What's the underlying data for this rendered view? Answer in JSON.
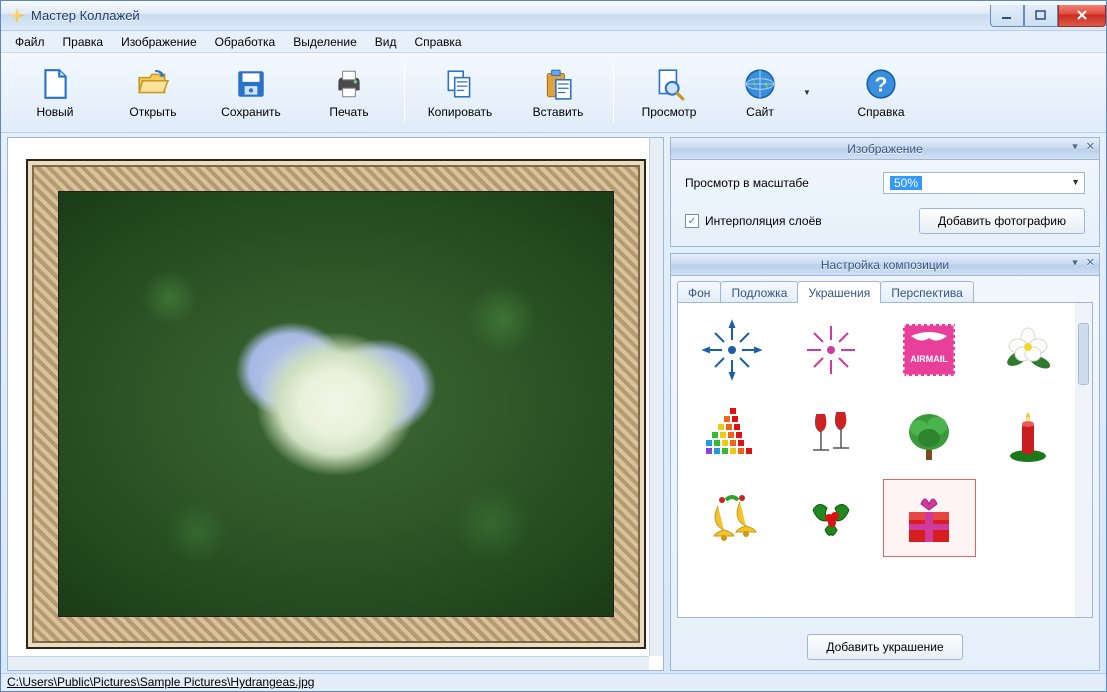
{
  "window": {
    "title": "Мастер Коллажей"
  },
  "menu": {
    "items": [
      "Файл",
      "Правка",
      "Изображение",
      "Обработка",
      "Выделение",
      "Вид",
      "Справка"
    ]
  },
  "toolbar": {
    "new": "Новый",
    "open": "Открыть",
    "save": "Сохранить",
    "print": "Печать",
    "copy": "Копировать",
    "paste": "Вставить",
    "preview": "Просмотр",
    "site": "Сайт",
    "help": "Справка"
  },
  "panel_image": {
    "title": "Изображение",
    "zoom_label": "Просмотр в масштабе",
    "zoom_value": "50%",
    "interpolation_label": "Интерполяция слоёв",
    "interpolation_checked": true,
    "add_photo": "Добавить фотографию"
  },
  "panel_composition": {
    "title": "Настройка композиции",
    "tabs": [
      "Фон",
      "Подложка",
      "Украшения",
      "Перспектива"
    ],
    "active_tab": 2,
    "add_decoration": "Добавить украшение",
    "stickers": [
      "firework-blue",
      "firework-pink",
      "airmail-stamp",
      "white-flower",
      "color-squares",
      "wine-glasses",
      "green-tree",
      "red-candle",
      "gold-bells",
      "holly-leaves",
      "gift-box"
    ],
    "selected_sticker": 10
  },
  "status": {
    "path": "C:\\Users\\Public\\Pictures\\Sample Pictures\\Hydrangeas.jpg"
  }
}
